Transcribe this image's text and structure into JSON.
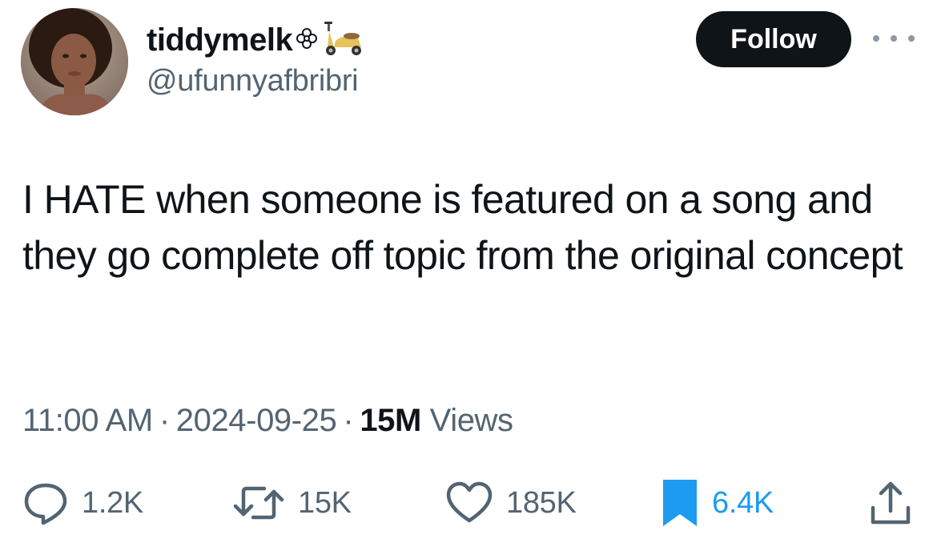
{
  "author": {
    "display_name": "tiddymelk",
    "name_emoji_1": "flower-emoji",
    "name_emoji_2": "scooter-emoji",
    "handle": "@ufunnyafbribri",
    "avatar": "profile-avatar"
  },
  "header": {
    "follow_label": "Follow",
    "more_icon": "more-options-icon"
  },
  "tweet": {
    "text": "I HATE when someone is featured on a song and they go complete off topic from the original concept"
  },
  "meta": {
    "time": "11:00 AM",
    "separator": "·",
    "date": "2024-09-25",
    "views_count": "15M",
    "views_label": "Views"
  },
  "actions": {
    "replies": "1.2K",
    "reposts": "15K",
    "likes": "185K",
    "bookmarks": "6.4K"
  },
  "colors": {
    "text": "#0f1419",
    "secondary": "#536471",
    "accent": "#1d9bf0",
    "follow_bg": "#0f1419"
  }
}
